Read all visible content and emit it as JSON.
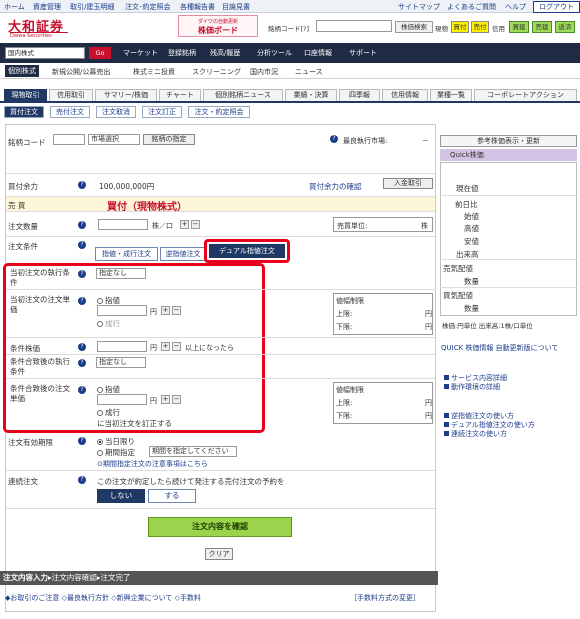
{
  "topnav": {
    "home": "ホーム",
    "assets": "資産管理",
    "trade_history": "取引/建玉明細",
    "order_inquiry": "注文･約定照会",
    "reports": "各種報告書",
    "contents": "目論見書",
    "sitemap": "サイトマップ",
    "faq": "よくあるご質問",
    "help": "ヘルプ",
    "logout": "ログアウト"
  },
  "header": {
    "logo": "大和証券",
    "logo_sub": "Daiwa Securities",
    "board_top": "ダイワの自動更新",
    "board_main": "株価ボード",
    "code_label": "銘柄コード[?]",
    "stock_search": "株価検索",
    "cash_label": "現物",
    "buy": "買付",
    "sell": "売付",
    "margin_label": "信用",
    "new_buy": "買建",
    "new_sell": "売建",
    "close": "返済"
  },
  "darknav": {
    "select_value": "国内株式",
    "go": "Go",
    "items": [
      "マーケット",
      "登録銘柄",
      "残高/履歴",
      "分析ツール",
      "口座情報",
      "サポート"
    ]
  },
  "subnav": {
    "items": [
      "個別株式",
      "新規公開/公募売出",
      "株式ミニ投資",
      "スクリーニング",
      "国内市況",
      "ニュース"
    ]
  },
  "tabs": [
    "現物取引",
    "信用取引",
    "サマリー/株価",
    "チャート",
    "個別銘柄ニュース",
    "業績・決算",
    "四季報",
    "信用情報",
    "業種一覧",
    "コーポレートアクション"
  ],
  "subtabs": [
    "買付注文",
    "売付注文",
    "注文取消",
    "注文訂正",
    "注文・約定照会"
  ],
  "form": {
    "code_label": "銘柄コード",
    "market_select": "市場選択",
    "specify_btn": "銘柄の指定",
    "best_market_label": "最良執行市場:",
    "best_market_value": "－",
    "buying_power_label": "買付余力",
    "buying_power_value": "100,000,000円",
    "check_power": "買付余力の確認",
    "deposit_btn": "入金取引",
    "side_label": "売 買",
    "side_value": "買付（現物株式）",
    "qty_label": "注文数量",
    "qty_unit": "株／口",
    "trade_unit_label": "売買単位:",
    "trade_unit_value": "株",
    "cond_label": "注文条件",
    "cond_tabs": [
      "指値・成行注文",
      "逆指値注文",
      "デュアル指値注文"
    ],
    "when_cond_label": "当初注文の執行条件",
    "none": "指定なし",
    "when_price_label": "当初注文の注文単価",
    "limit": "指値",
    "market": "成行",
    "yen": "円",
    "range_label": "値幅制限",
    "upper": "上限:",
    "lower": "下限:",
    "cond_price_label": "条件株価",
    "cond_suffix": "以上になったら",
    "after_cond_label": "条件合致後の執行条件",
    "after_price_label": "条件合致後の注文単価",
    "revise_text": "に当初注文を訂正する",
    "validity_label": "注文有効期限",
    "today": "当日限り",
    "period": "期間指定",
    "period_select": "期間を指定してください",
    "period_note": "期間指定注文の注意事項はこちら",
    "chain_label": "連続注文",
    "chain_text": "この注文が約定したら続けて発注する売付注文の予約を",
    "no": "しない",
    "yes": "する",
    "confirm": "注文内容を確認",
    "clear": "クリア"
  },
  "steps": {
    "s1": "注文内容入力",
    "s2": "注文内容確認",
    "s3": "注文完了"
  },
  "footer": {
    "links": [
      "お取引のご注意",
      "最良執行方針",
      "新興企業について",
      "手数料"
    ],
    "fee": "［手数料方式の変更］"
  },
  "right": {
    "ref_btn": "参考株価表示・更新",
    "quick": "Quick株価",
    "rows": [
      "現在値",
      "前日比",
      "始値",
      "高値",
      "安値",
      "出来高",
      "売気配値",
      "数量",
      "買気配値",
      "数量"
    ],
    "unit_note": "株価:円単位 出来高:1株/口単位",
    "quick_note": "QUICK 株価情報 自動更新版について",
    "links1": [
      "サービス内容詳細",
      "動作環境の詳細"
    ],
    "links2": [
      "逆指値注文の使い方",
      "デュアル指値注文の使い方",
      "連続注文の使い方"
    ]
  },
  "colors": {
    "accent": "#e8001c",
    "nav": "#1f2a44",
    "tab": "#1f3864",
    "confirm": "#9bd34c"
  }
}
